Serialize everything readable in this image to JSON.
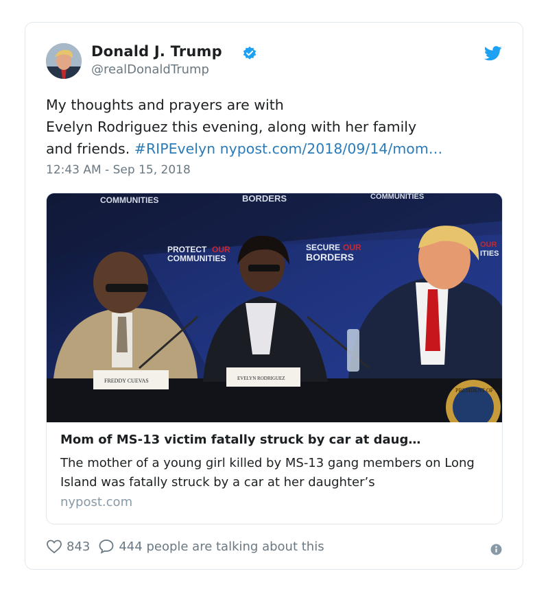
{
  "tweet": {
    "author_name": "Donald J. Trump",
    "handle": "@realDonaldTrump",
    "verified": true,
    "text_lines": [
      "My thoughts and prayers are with",
      "Evelyn Rodriguez this evening, along with her family"
    ],
    "text_line3_plain": "and friends. ",
    "hashtag": "#RIPEvelyn",
    "url": "nypost.com/2018/09/14/mom…",
    "timestamp": "12:43 AM - Sep 15, 2018"
  },
  "link_card": {
    "title": "Mom of MS-13 victim fatally struck by car at daug…",
    "description": "The mother of a young girl killed by MS-13 gang members on Long Island was fatally struck by a car at her daughter’s",
    "domain": "nypost.com",
    "photo_signs": {
      "top_left": "COMMUNITIES",
      "top_center": "BORDERS",
      "top_right": "COMMUNITIES",
      "mid_left_1": "PROTECT",
      "mid_left_1b": "OUR",
      "mid_left_2": "COMMUNITIES",
      "mid_center_1": "SECURE",
      "mid_center_1b": "OUR",
      "mid_center_2": "BORDERS",
      "mid_right_1": "OUR",
      "mid_right_2": "ITIES",
      "placard_left": "FREDDY CUEVAS",
      "placard_center": "EVELYN RODRIGUEZ",
      "seal": "PRESIDENT OF THE"
    }
  },
  "actions": {
    "likes": "843",
    "talking": "444 people are talking about this"
  },
  "colors": {
    "link": "#2b7bb9",
    "verified": "#1da1f2",
    "muted": "#697882",
    "border": "#e1e8ed"
  },
  "icons": [
    "twitter-bird-icon",
    "verified-badge-icon",
    "heart-icon",
    "speech-bubble-icon",
    "info-icon"
  ]
}
